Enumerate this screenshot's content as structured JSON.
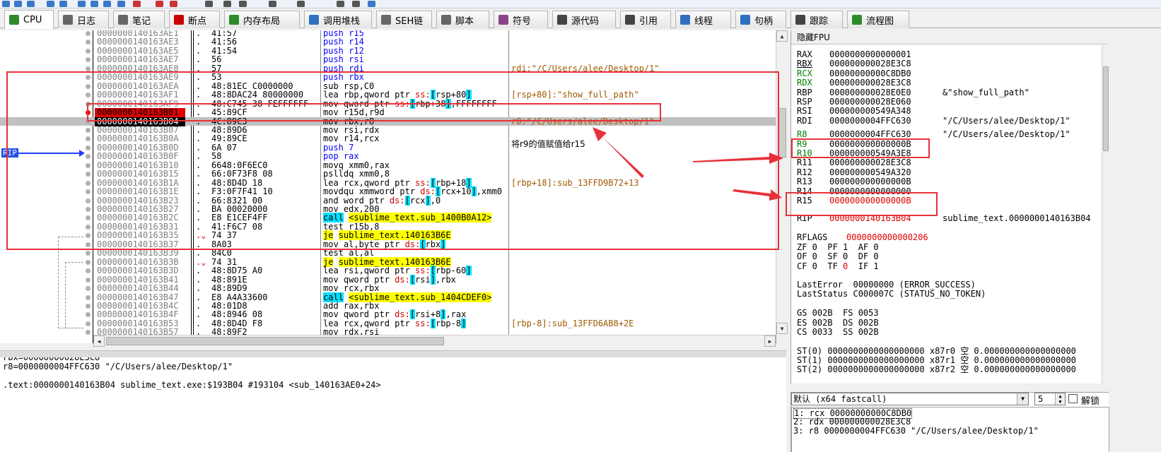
{
  "tabs": [
    {
      "label": "CPU",
      "icon": "cpu-icon",
      "color": "#2d8a2d"
    },
    {
      "label": "日志",
      "icon": "log-icon",
      "color": "#666666"
    },
    {
      "label": "笔记",
      "icon": "note-icon",
      "color": "#666666"
    },
    {
      "label": "断点",
      "icon": "breakpoint-icon",
      "color": "#cc0000"
    },
    {
      "label": "内存布局",
      "icon": "memory-map-icon",
      "color": "#2d8a2d"
    },
    {
      "label": "调用堆栈",
      "icon": "call-stack-icon",
      "color": "#3070c0"
    },
    {
      "label": "SEH链",
      "icon": "seh-icon",
      "color": "#666666"
    },
    {
      "label": "脚本",
      "icon": "script-icon",
      "color": "#666666"
    },
    {
      "label": "符号",
      "icon": "symbol-icon",
      "color": "#884488"
    },
    {
      "label": "源代码",
      "icon": "source-icon",
      "color": "#444444"
    },
    {
      "label": "引用",
      "icon": "reference-icon",
      "color": "#444444"
    },
    {
      "label": "线程",
      "icon": "thread-icon",
      "color": "#3070c0"
    },
    {
      "label": "句柄",
      "icon": "handle-icon",
      "color": "#3070c0"
    },
    {
      "label": "跟踪",
      "icon": "trace-icon",
      "color": "#444444"
    },
    {
      "label": "流程图",
      "icon": "graph-icon",
      "color": "#2d8a2d"
    }
  ],
  "disasm": [
    {
      "addr": "0000000140163AE1",
      "dot": ".",
      "bytes": "41:57",
      "instr": "push r15",
      "kind": "push",
      "cmt": ""
    },
    {
      "addr": "0000000140163AE3",
      "dot": ".",
      "bytes": "41:56",
      "instr": "push r14",
      "kind": "push",
      "cmt": ""
    },
    {
      "addr": "0000000140163AE5",
      "dot": ".",
      "bytes": "41:54",
      "instr": "push r12",
      "kind": "push",
      "cmt": ""
    },
    {
      "addr": "0000000140163AE7",
      "dot": ".",
      "bytes": "56",
      "instr": "push rsi",
      "kind": "push",
      "cmt": ""
    },
    {
      "addr": "0000000140163AE8",
      "dot": ".",
      "bytes": "57",
      "instr": "push rdi",
      "kind": "push",
      "cmt": "rdi:\"/C/Users/alee/Desktop/1\"",
      "cmtc": "olive"
    },
    {
      "addr": "0000000140163AE9",
      "dot": ".",
      "bytes": "53",
      "instr": "push rbx",
      "kind": "push",
      "cmt": ""
    },
    {
      "addr": "0000000140163AEA",
      "dot": ".",
      "bytes": "48:81EC C0000000",
      "instr": "sub rsp,C0",
      "kind": "",
      "cmt": ""
    },
    {
      "addr": "0000000140163AF1",
      "dot": ".",
      "bytes": "48:8DAC24 80000000",
      "instr": "lea rbp,qword ptr ss:[rsp+80]",
      "kind": "",
      "cmt": "[rsp+80]:\"show_full_path\"",
      "cmtc": "olive"
    },
    {
      "addr": "0000000140163AF9",
      "dot": ".",
      "bytes": "48:C745 38 FEFFFFFF",
      "instr": "mov qword ptr ss:[rbp+38],FFFFFFFF",
      "kind": "",
      "cmt": ""
    },
    {
      "addr": "0000000140163B01",
      "dot": ".",
      "bytes": "45:89CF",
      "instr": "mov r15d,r9d",
      "kind": "",
      "cmt": "",
      "mark": "cur"
    },
    {
      "addr": "0000000140163B04",
      "dot": ".",
      "bytes": "4C:89C3",
      "instr": "mov rbx,r8",
      "kind": "",
      "cmt": "r8:\"/C/Users/alee/Desktop/1\"",
      "cmtc": "olive",
      "mark": "rip"
    },
    {
      "addr": "0000000140163B07",
      "dot": ".",
      "bytes": "48:89D6",
      "instr": "mov rsi,rdx",
      "kind": "",
      "cmt": ""
    },
    {
      "addr": "0000000140163B0A",
      "dot": ".",
      "bytes": "49:89CE",
      "instr": "mov r14,rcx",
      "kind": "",
      "cmt": ""
    },
    {
      "addr": "0000000140163B0D",
      "dot": ".",
      "bytes": "6A 07",
      "instr": "push 7",
      "kind": "push",
      "cmt": ""
    },
    {
      "addr": "0000000140163B0F",
      "dot": ".",
      "bytes": "58",
      "instr": "pop rax",
      "kind": "push",
      "cmt": ""
    },
    {
      "addr": "0000000140163B10",
      "dot": ".",
      "bytes": "6648:0F6EC0",
      "instr": "movq xmm0,rax",
      "kind": "",
      "cmt": ""
    },
    {
      "addr": "0000000140163B15",
      "dot": ".",
      "bytes": "66:0F73F8 08",
      "instr": "pslldq xmm0,8",
      "kind": "",
      "cmt": ""
    },
    {
      "addr": "0000000140163B1A",
      "dot": ".",
      "bytes": "48:8D4D 18",
      "instr": "lea rcx,qword ptr ss:[rbp+18]",
      "kind": "",
      "cmt": "[rbp+18]:sub_13FFD9B72+13",
      "cmtc": "olive"
    },
    {
      "addr": "0000000140163B1E",
      "dot": ".",
      "bytes": "F3:0F7F41 10",
      "instr": "movdqu xmmword ptr ds:[rcx+10],xmm0",
      "kind": "",
      "cmt": ""
    },
    {
      "addr": "0000000140163B23",
      "dot": ".",
      "bytes": "66:8321 00",
      "instr": "and word ptr ds:[rcx],0",
      "kind": "",
      "cmt": ""
    },
    {
      "addr": "0000000140163B27",
      "dot": ".",
      "bytes": "BA 00020000",
      "instr": "mov edx,200",
      "kind": "",
      "cmt": ""
    },
    {
      "addr": "0000000140163B2C",
      "dot": ".",
      "bytes": "E8 E1CEF4FF",
      "instr": "call",
      "target": "<sublime_text.sub_1400B0A12>",
      "kind": "call",
      "cmt": ""
    },
    {
      "addr": "0000000140163B31",
      "dot": ".",
      "bytes": "41:F6C7 08",
      "instr": "test r15b,8",
      "kind": "",
      "cmt": ""
    },
    {
      "addr": "0000000140163B35",
      "dot": ".⌄",
      "bytes": "74 37",
      "instr": "je",
      "target": "sublime_text.140163B6E",
      "kind": "je",
      "cmt": ""
    },
    {
      "addr": "0000000140163B37",
      "dot": ".",
      "bytes": "8A03",
      "instr": "mov al,byte ptr ds:[rbx]",
      "kind": "",
      "cmt": ""
    },
    {
      "addr": "0000000140163B39",
      "dot": ".",
      "bytes": "84C0",
      "instr": "test al,al",
      "kind": "",
      "cmt": ""
    },
    {
      "addr": "0000000140163B3B",
      "dot": ".⌄",
      "bytes": "74 31",
      "instr": "je",
      "target": "sublime_text.140163B6E",
      "kind": "je",
      "cmt": ""
    },
    {
      "addr": "0000000140163B3D",
      "dot": ".",
      "bytes": "48:8D75 A0",
      "instr": "lea rsi,qword ptr ss:[rbp-60]",
      "kind": "",
      "cmt": ""
    },
    {
      "addr": "0000000140163B41",
      "dot": ".",
      "bytes": "48:891E",
      "instr": "mov qword ptr ds:[rsi],rbx",
      "kind": "",
      "cmt": ""
    },
    {
      "addr": "0000000140163B44",
      "dot": ".",
      "bytes": "48:89D9",
      "instr": "mov rcx,rbx",
      "kind": "",
      "cmt": ""
    },
    {
      "addr": "0000000140163B47",
      "dot": ".",
      "bytes": "E8 A4A33600",
      "instr": "call",
      "target": "<sublime_text.sub_1404CDEF0>",
      "kind": "call",
      "cmt": ""
    },
    {
      "addr": "0000000140163B4C",
      "dot": ".",
      "bytes": "48:01D8",
      "instr": "add rax,rbx",
      "kind": "",
      "cmt": ""
    },
    {
      "addr": "0000000140163B4F",
      "dot": ".",
      "bytes": "48:8946 08",
      "instr": "mov qword ptr ds:[rsi+8],rax",
      "kind": "",
      "cmt": ""
    },
    {
      "addr": "0000000140163B53",
      "dot": ".",
      "bytes": "48:8D4D F8",
      "instr": "lea rcx,qword ptr ss:[rbp-8]",
      "kind": "",
      "cmt": "[rbp-8]:sub_13FFD6AB8+2E",
      "cmtc": "olive"
    },
    {
      "addr": "0000000140163B57",
      "dot": ".",
      "bytes": "48:89F2",
      "instr": "mov rdx,rsi",
      "kind": "",
      "cmt": ""
    }
  ],
  "rip_label": "RIP",
  "annotation": "将r9的值赋值给r15",
  "info_lines": [
    "rbx=00000000028E3C8",
    "r8=0000000004FFC630 \"/C/Users/alee/Desktop/1\"",
    "",
    ".text:0000000140163B04 sublime_text.exe:$193B04 #193104 <sub_140163AE0+24>"
  ],
  "registers_header": "隐藏FPU",
  "registers": [
    {
      "name": "RAX",
      "value": "0000000000000001",
      "comment": "",
      "nc": "",
      "vc": ""
    },
    {
      "name": "RBX",
      "value": "000000000028E3C8",
      "comment": "",
      "nc": "ul",
      "vc": ""
    },
    {
      "name": "RCX",
      "value": "00000000000C8DB0",
      "comment": "",
      "nc": "green",
      "vc": ""
    },
    {
      "name": "RDX",
      "value": "000000000028E3C8",
      "comment": "",
      "nc": "green",
      "vc": ""
    },
    {
      "name": "RBP",
      "value": "000000000028E0E0",
      "comment": "&\"show_full_path\"",
      "nc": "",
      "vc": ""
    },
    {
      "name": "RSP",
      "value": "000000000028E060",
      "comment": "",
      "nc": "",
      "vc": ""
    },
    {
      "name": "RSI",
      "value": "000000000549A348",
      "comment": "",
      "nc": "",
      "vc": ""
    },
    {
      "name": "RDI",
      "value": "0000000004FFC630",
      "comment": "\"/C/Users/alee/Desktop/1\"",
      "nc": "",
      "vc": ""
    },
    {
      "name": "",
      "value": "",
      "comment": "",
      "nc": "",
      "vc": ""
    },
    {
      "name": "R8",
      "value": "0000000004FFC630",
      "comment": "\"/C/Users/alee/Desktop/1\"",
      "nc": "green",
      "vc": ""
    },
    {
      "name": "R9",
      "value": "000000000000000B",
      "comment": "",
      "nc": "green",
      "vc": ""
    },
    {
      "name": "R10",
      "value": "000000000549A3E8",
      "comment": "",
      "nc": "green",
      "vc": ""
    },
    {
      "name": "R11",
      "value": "000000000028E3C8",
      "comment": "",
      "nc": "",
      "vc": ""
    },
    {
      "name": "R12",
      "value": "000000000549A320",
      "comment": "",
      "nc": "",
      "vc": ""
    },
    {
      "name": "R13",
      "value": "000000000000000B",
      "comment": "",
      "nc": "",
      "vc": ""
    },
    {
      "name": "R14",
      "value": "0000000000000000",
      "comment": "",
      "nc": "",
      "vc": ""
    },
    {
      "name": "R15",
      "value": "000000000000000B",
      "comment": "",
      "nc": "",
      "vc": "red"
    }
  ],
  "rip": {
    "name": "RIP",
    "value": "0000000140163B04",
    "comment": "sublime_text.0000000140163B04"
  },
  "rflags": {
    "name": "RFLAGS",
    "value": "0000000000000206"
  },
  "flags": [
    "ZF 0  PF 1  AF 0",
    "OF 0  SF 0  DF 0",
    "CF 0  TF 0  IF 1"
  ],
  "last_error": "LastError  00000000 (ERROR_SUCCESS)",
  "last_status": "LastStatus C000007C (STATUS_NO_TOKEN)",
  "segments": [
    "GS 002B  FS 0053",
    "ES 002B  DS 002B",
    "CS 0033  SS 002B"
  ],
  "fpu": [
    "ST(0) 0000000000000000000 x87r0 空 0.000000000000000000",
    "ST(1) 0000000000000000000 x87r1 空 0.000000000000000000",
    "ST(2) 0000000000000000000 x87r2 空 0.000000000000000000"
  ],
  "callconv": {
    "selected": "默认 (x64 fastcall)",
    "count": "5",
    "lock_label": "解锁",
    "items": [
      "1: rcx 00000000000C8DB0",
      "2: rdx 000000000028E3C8",
      "3: r8 0000000004FFC630 \"/C/Users/alee/Desktop/1\""
    ]
  },
  "colors": {
    "accent": "#e8303a",
    "rip_blue": "#2040ff",
    "call_bg": "#00e0ff",
    "je_bg": "#ffff00"
  }
}
